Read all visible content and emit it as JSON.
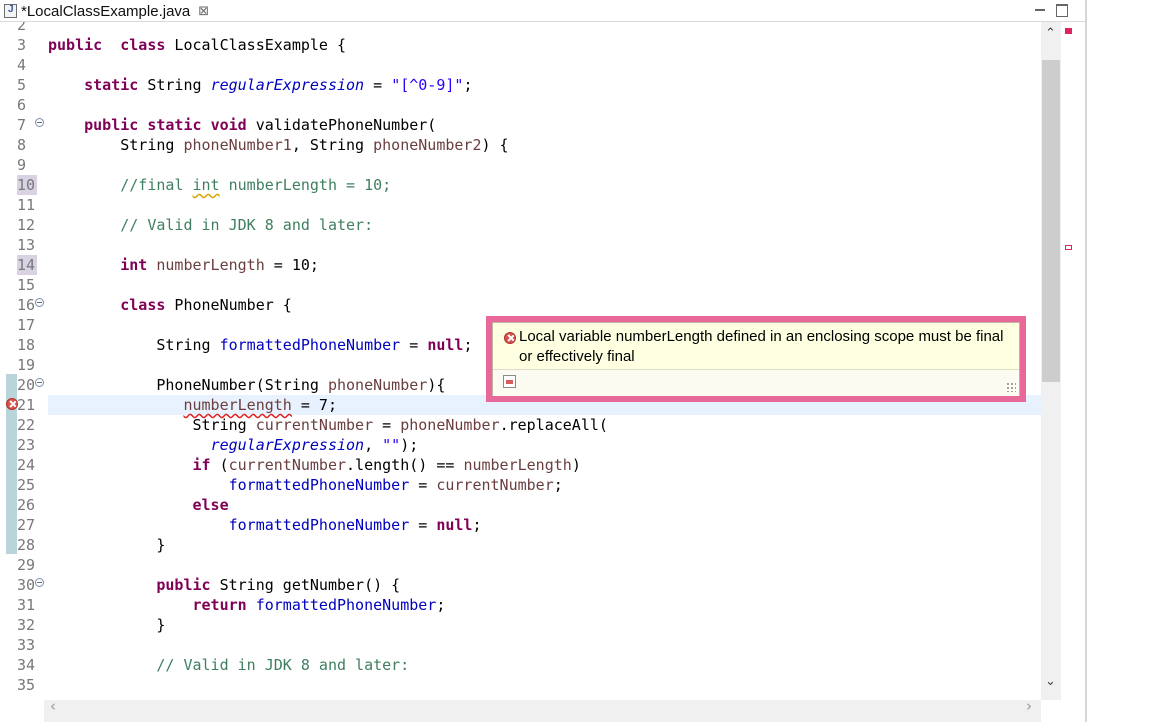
{
  "tab": {
    "title": "*LocalClassExample.java",
    "close_glyph": "⊠"
  },
  "window": {
    "minimize_label": "minimize",
    "maximize_label": "maximize"
  },
  "editor": {
    "lines": [
      {
        "n": "2",
        "tokens": []
      },
      {
        "n": "3",
        "tokens": [
          [
            "kw",
            "public"
          ],
          [
            "",
            "  "
          ],
          [
            "kw",
            "class"
          ],
          [
            "",
            " LocalClassExample {"
          ]
        ]
      },
      {
        "n": "4",
        "tokens": []
      },
      {
        "n": "5",
        "tokens": [
          [
            "",
            "    "
          ],
          [
            "kw",
            "static"
          ],
          [
            "",
            " String "
          ],
          [
            "st",
            "regularExpression"
          ],
          [
            "",
            " = "
          ],
          [
            "str",
            "\"[^0-9]\""
          ],
          [
            "",
            ";"
          ]
        ]
      },
      {
        "n": "6",
        "tokens": []
      },
      {
        "n": "7",
        "fold": true,
        "tokens": [
          [
            "",
            "    "
          ],
          [
            "kw",
            "public"
          ],
          [
            "",
            " "
          ],
          [
            "kw",
            "static"
          ],
          [
            "",
            " "
          ],
          [
            "kw",
            "void"
          ],
          [
            "",
            " validatePhoneNumber("
          ]
        ]
      },
      {
        "n": "8",
        "tokens": [
          [
            "",
            "        String "
          ],
          [
            "pa",
            "phoneNumber1"
          ],
          [
            "",
            ", String "
          ],
          [
            "pa",
            "phoneNumber2"
          ],
          [
            "",
            ") {"
          ]
        ]
      },
      {
        "n": "9",
        "tokens": []
      },
      {
        "n": "10",
        "hl": true,
        "tokens": [
          [
            "",
            "        "
          ],
          [
            "cm",
            "//final "
          ],
          [
            "cm warn",
            "int"
          ],
          [
            "cm",
            " numberLength = 10;"
          ]
        ]
      },
      {
        "n": "11",
        "tokens": []
      },
      {
        "n": "12",
        "tokens": [
          [
            "",
            "        "
          ],
          [
            "cm",
            "// Valid in JDK 8 and later:"
          ]
        ]
      },
      {
        "n": "13",
        "tokens": []
      },
      {
        "n": "14",
        "hl": true,
        "tokens": [
          [
            "",
            "        "
          ],
          [
            "kw",
            "int"
          ],
          [
            "",
            " "
          ],
          [
            "lv",
            "numberLength"
          ],
          [
            "",
            " = 10;"
          ]
        ]
      },
      {
        "n": "15",
        "tokens": []
      },
      {
        "n": "16",
        "fold": true,
        "tokens": [
          [
            "",
            "        "
          ],
          [
            "kw",
            "class"
          ],
          [
            "",
            " PhoneNumber {"
          ]
        ]
      },
      {
        "n": "17",
        "tokens": []
      },
      {
        "n": "18",
        "tokens": [
          [
            "",
            "            String "
          ],
          [
            "fi",
            "formattedPhoneNumber"
          ],
          [
            "",
            " = "
          ],
          [
            "kw",
            "null"
          ],
          [
            "",
            ";"
          ]
        ]
      },
      {
        "n": "19",
        "tokens": []
      },
      {
        "n": "20",
        "fold": true,
        "tokens": [
          [
            "",
            "            PhoneNumber(String "
          ],
          [
            "pa",
            "phoneNumber"
          ],
          [
            "",
            "){"
          ]
        ]
      },
      {
        "n": "21",
        "error": true,
        "tokens": [
          [
            "",
            "               "
          ],
          [
            "lv errsq",
            "numberLength"
          ],
          [
            "",
            " = 7;"
          ]
        ]
      },
      {
        "n": "22",
        "tokens": [
          [
            "",
            "                String "
          ],
          [
            "lv",
            "currentNumber"
          ],
          [
            "",
            " = "
          ],
          [
            "pa",
            "phoneNumber"
          ],
          [
            "",
            ".replaceAll("
          ]
        ]
      },
      {
        "n": "23",
        "tokens": [
          [
            "",
            "                  "
          ],
          [
            "st",
            "regularExpression"
          ],
          [
            "",
            ", "
          ],
          [
            "str",
            "\"\""
          ],
          [
            "",
            ");"
          ]
        ]
      },
      {
        "n": "24",
        "tokens": [
          [
            "",
            "                "
          ],
          [
            "kw",
            "if"
          ],
          [
            "",
            " ("
          ],
          [
            "lv",
            "currentNumber"
          ],
          [
            "",
            ".length() == "
          ],
          [
            "lv",
            "numberLength"
          ],
          [
            "",
            ")"
          ]
        ]
      },
      {
        "n": "25",
        "tokens": [
          [
            "",
            "                    "
          ],
          [
            "fi",
            "formattedPhoneNumber"
          ],
          [
            "",
            " = "
          ],
          [
            "lv",
            "currentNumber"
          ],
          [
            "",
            ";"
          ]
        ]
      },
      {
        "n": "26",
        "tokens": [
          [
            "",
            "                "
          ],
          [
            "kw",
            "else"
          ]
        ]
      },
      {
        "n": "27",
        "tokens": [
          [
            "",
            "                    "
          ],
          [
            "fi",
            "formattedPhoneNumber"
          ],
          [
            "",
            " = "
          ],
          [
            "kw",
            "null"
          ],
          [
            "",
            ";"
          ]
        ]
      },
      {
        "n": "28",
        "tokens": [
          [
            "",
            "            }"
          ]
        ]
      },
      {
        "n": "29",
        "tokens": []
      },
      {
        "n": "30",
        "fold": true,
        "tokens": [
          [
            "",
            "            "
          ],
          [
            "kw",
            "public"
          ],
          [
            "",
            " String getNumber() {"
          ]
        ]
      },
      {
        "n": "31",
        "tokens": [
          [
            "",
            "                "
          ],
          [
            "kw",
            "return"
          ],
          [
            "",
            " "
          ],
          [
            "fi",
            "formattedPhoneNumber"
          ],
          [
            "",
            ";"
          ]
        ]
      },
      {
        "n": "32",
        "tokens": [
          [
            "",
            "            }"
          ]
        ]
      },
      {
        "n": "33",
        "tokens": []
      },
      {
        "n": "34",
        "tokens": [
          [
            "",
            "            "
          ],
          [
            "cm",
            "// Valid in JDK 8 and later:"
          ]
        ]
      },
      {
        "n": "35",
        "tokens": []
      }
    ]
  },
  "hover_popup": {
    "message": "Local variable numberLength defined in an enclosing scope must be final or effectively final",
    "severity": "error"
  },
  "scrollbars": {
    "up_glyph": "⌃",
    "down_glyph": "⌄",
    "left_glyph": "‹",
    "right_glyph": "›"
  },
  "colors": {
    "keyword": "#7f0055",
    "field": "#0000c0",
    "string": "#2a00ff",
    "comment": "#3f7f5f",
    "local_var": "#6a3e3e",
    "popup_border": "#e8689a",
    "popup_bg": "#ffffe1",
    "error": "#d9534f"
  }
}
